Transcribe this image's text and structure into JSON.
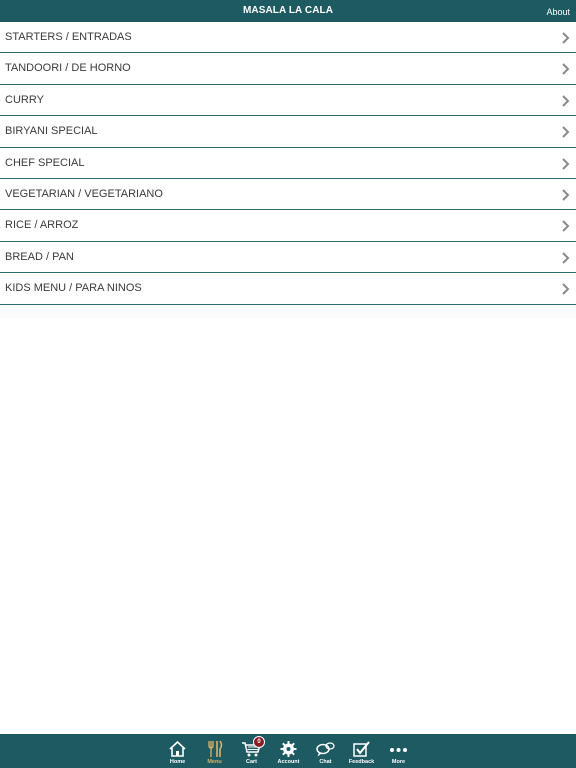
{
  "header": {
    "title": "MASALA LA CALA",
    "about_label": "About"
  },
  "menu": {
    "items": [
      {
        "label": "STARTERS / ENTRADAS"
      },
      {
        "label": "TANDOORI / DE HORNO"
      },
      {
        "label": "CURRY"
      },
      {
        "label": "BIRYANI SPECIAL"
      },
      {
        "label": "CHEF SPECIAL"
      },
      {
        "label": "VEGETARIAN / VEGETARIANO"
      },
      {
        "label": "RICE / ARROZ"
      },
      {
        "label": "BREAD / PAN"
      },
      {
        "label": "KIDS MENU / PARA NINOS"
      }
    ]
  },
  "tabbar": {
    "active": "Menu",
    "cart_count": "0",
    "tabs": [
      {
        "label": "Home",
        "icon": "home-icon"
      },
      {
        "label": "Menu",
        "icon": "fork-knife-icon"
      },
      {
        "label": "Cart",
        "icon": "cart-icon"
      },
      {
        "label": "Account",
        "icon": "gear-icon"
      },
      {
        "label": "Chat",
        "icon": "chat-bubbles-icon"
      },
      {
        "label": "Feedback",
        "icon": "checkbox-icon"
      },
      {
        "label": "More",
        "icon": "more-dots-icon"
      }
    ]
  },
  "colors": {
    "bar": "#1e5a61",
    "active_tab": "#d9b26a",
    "badge": "#8b1d22"
  }
}
